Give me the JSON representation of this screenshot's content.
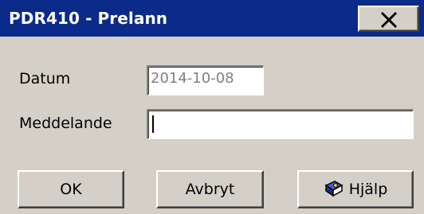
{
  "window": {
    "title": "PDR410 - Prelann",
    "close_label": "X"
  },
  "form": {
    "date_label": "Datum",
    "date_value": "2014-10-08",
    "message_label": "Meddelande",
    "message_value": ""
  },
  "buttons": {
    "ok_label": "OK",
    "cancel_label": "Avbryt",
    "help_label": "Hjälp",
    "help_icon": "help-book-icon"
  },
  "colors": {
    "titlebar": "#0b2a8a",
    "face": "#d4d0c8",
    "field": "#ffffff",
    "disabled_text": "#808080"
  }
}
